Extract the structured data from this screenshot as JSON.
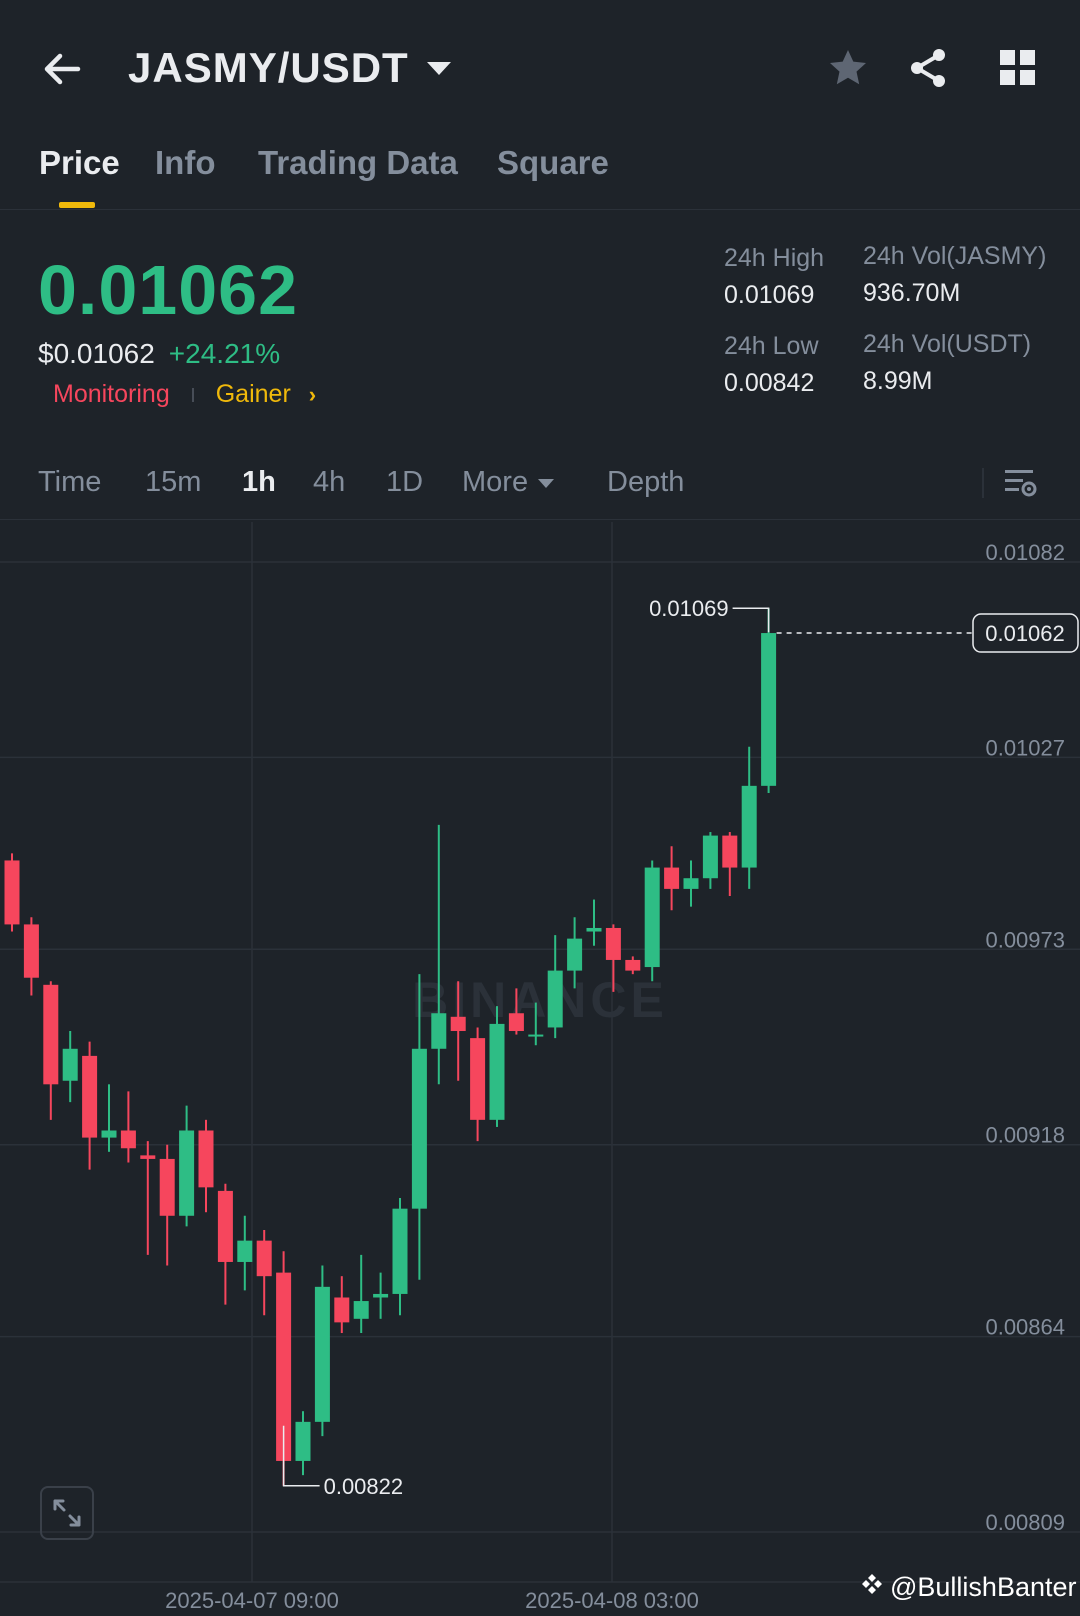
{
  "header": {
    "pair": "JASMY/USDT",
    "icons": [
      "back-arrow-icon",
      "star-icon",
      "share-icon",
      "grid-icon"
    ]
  },
  "tabs": [
    {
      "label": "Price",
      "active": true
    },
    {
      "label": "Info",
      "active": false
    },
    {
      "label": "Trading Data",
      "active": false
    },
    {
      "label": "Square",
      "active": false
    }
  ],
  "ticker": {
    "last_price": "0.01062",
    "usd_price": "$0.01062",
    "change": "+24.21%",
    "tag_monitoring": "Monitoring",
    "tag_gainer": "Gainer",
    "high_label": "24h High",
    "high_value": "0.01069",
    "low_label": "24h Low",
    "low_value": "0.00842",
    "vol_base_label": "24h Vol(JASMY)",
    "vol_base_value": "936.70M",
    "vol_quote_label": "24h Vol(USDT)",
    "vol_quote_value": "8.99M"
  },
  "intervals": {
    "items": [
      {
        "label": "Time",
        "active": false
      },
      {
        "label": "15m",
        "active": false
      },
      {
        "label": "1h",
        "active": true
      },
      {
        "label": "4h",
        "active": false
      },
      {
        "label": "1D",
        "active": false
      },
      {
        "label": "More",
        "active": false
      },
      {
        "label": "Depth",
        "active": false
      }
    ]
  },
  "colors": {
    "up": "#2ebd85",
    "down": "#f6465d",
    "accent": "#f0b90b",
    "background": "#1e2329",
    "grid": "#2b3139",
    "muted": "#848e9c"
  },
  "chart_data": {
    "type": "candlestick",
    "ylim": [
      0.00809,
      0.01082
    ],
    "y_ticks": [
      "0.01082",
      "0.01027",
      "0.00973",
      "0.00918",
      "0.00864",
      "0.00809"
    ],
    "x_ticks": [
      "2025-04-07 09:00",
      "2025-04-08 03:00"
    ],
    "current_price_label": "0.01062",
    "high_marker": "0.01069",
    "low_marker": "0.00822",
    "watermark": "BINANCE",
    "candles": [
      {
        "o": 0.00998,
        "h": 0.01,
        "l": 0.00978,
        "c": 0.0098
      },
      {
        "o": 0.0098,
        "h": 0.00982,
        "l": 0.0096,
        "c": 0.00965
      },
      {
        "o": 0.00963,
        "h": 0.00964,
        "l": 0.00925,
        "c": 0.00935
      },
      {
        "o": 0.00936,
        "h": 0.0095,
        "l": 0.0093,
        "c": 0.00945
      },
      {
        "o": 0.00943,
        "h": 0.00947,
        "l": 0.00911,
        "c": 0.0092
      },
      {
        "o": 0.0092,
        "h": 0.00935,
        "l": 0.00916,
        "c": 0.00922
      },
      {
        "o": 0.00922,
        "h": 0.00933,
        "l": 0.00913,
        "c": 0.00917
      },
      {
        "o": 0.00915,
        "h": 0.00919,
        "l": 0.00887,
        "c": 0.00914
      },
      {
        "o": 0.00914,
        "h": 0.00918,
        "l": 0.00884,
        "c": 0.00898
      },
      {
        "o": 0.00898,
        "h": 0.00929,
        "l": 0.00895,
        "c": 0.00922
      },
      {
        "o": 0.00922,
        "h": 0.00925,
        "l": 0.00899,
        "c": 0.00906
      },
      {
        "o": 0.00905,
        "h": 0.00907,
        "l": 0.00873,
        "c": 0.00885
      },
      {
        "o": 0.00885,
        "h": 0.00898,
        "l": 0.00877,
        "c": 0.00891
      },
      {
        "o": 0.00891,
        "h": 0.00894,
        "l": 0.0087,
        "c": 0.00881
      },
      {
        "o": 0.00882,
        "h": 0.00888,
        "l": 0.00822,
        "c": 0.00829
      },
      {
        "o": 0.00829,
        "h": 0.00843,
        "l": 0.00825,
        "c": 0.0084
      },
      {
        "o": 0.0084,
        "h": 0.00884,
        "l": 0.00836,
        "c": 0.00878
      },
      {
        "o": 0.00875,
        "h": 0.00881,
        "l": 0.00865,
        "c": 0.00868
      },
      {
        "o": 0.00869,
        "h": 0.00887,
        "l": 0.00865,
        "c": 0.00874
      },
      {
        "o": 0.00875,
        "h": 0.00882,
        "l": 0.00869,
        "c": 0.00876
      },
      {
        "o": 0.00876,
        "h": 0.00903,
        "l": 0.0087,
        "c": 0.009
      },
      {
        "o": 0.009,
        "h": 0.00966,
        "l": 0.0088,
        "c": 0.00945
      },
      {
        "o": 0.00945,
        "h": 0.01008,
        "l": 0.00935,
        "c": 0.00955
      },
      {
        "o": 0.00954,
        "h": 0.00964,
        "l": 0.00936,
        "c": 0.0095
      },
      {
        "o": 0.00948,
        "h": 0.00951,
        "l": 0.00919,
        "c": 0.00925
      },
      {
        "o": 0.00925,
        "h": 0.00957,
        "l": 0.00923,
        "c": 0.00952
      },
      {
        "o": 0.00955,
        "h": 0.00962,
        "l": 0.00949,
        "c": 0.0095
      },
      {
        "o": 0.00949,
        "h": 0.00958,
        "l": 0.00946,
        "c": 0.00949
      },
      {
        "o": 0.00951,
        "h": 0.00977,
        "l": 0.00948,
        "c": 0.00967
      },
      {
        "o": 0.00967,
        "h": 0.00982,
        "l": 0.00962,
        "c": 0.00976
      },
      {
        "o": 0.00978,
        "h": 0.00987,
        "l": 0.00974,
        "c": 0.00979
      },
      {
        "o": 0.00979,
        "h": 0.0098,
        "l": 0.00961,
        "c": 0.0097
      },
      {
        "o": 0.0097,
        "h": 0.00971,
        "l": 0.00966,
        "c": 0.00967
      },
      {
        "o": 0.00968,
        "h": 0.00998,
        "l": 0.00964,
        "c": 0.00996
      },
      {
        "o": 0.00996,
        "h": 0.01002,
        "l": 0.00984,
        "c": 0.0099
      },
      {
        "o": 0.0099,
        "h": 0.00998,
        "l": 0.00985,
        "c": 0.00993
      },
      {
        "o": 0.00993,
        "h": 0.01006,
        "l": 0.0099,
        "c": 0.01005
      },
      {
        "o": 0.01005,
        "h": 0.01006,
        "l": 0.00988,
        "c": 0.00996
      },
      {
        "o": 0.00996,
        "h": 0.0103,
        "l": 0.0099,
        "c": 0.01019
      },
      {
        "o": 0.01019,
        "h": 0.01069,
        "l": 0.01017,
        "c": 0.01062
      }
    ]
  },
  "credit": "@BullishBanter"
}
